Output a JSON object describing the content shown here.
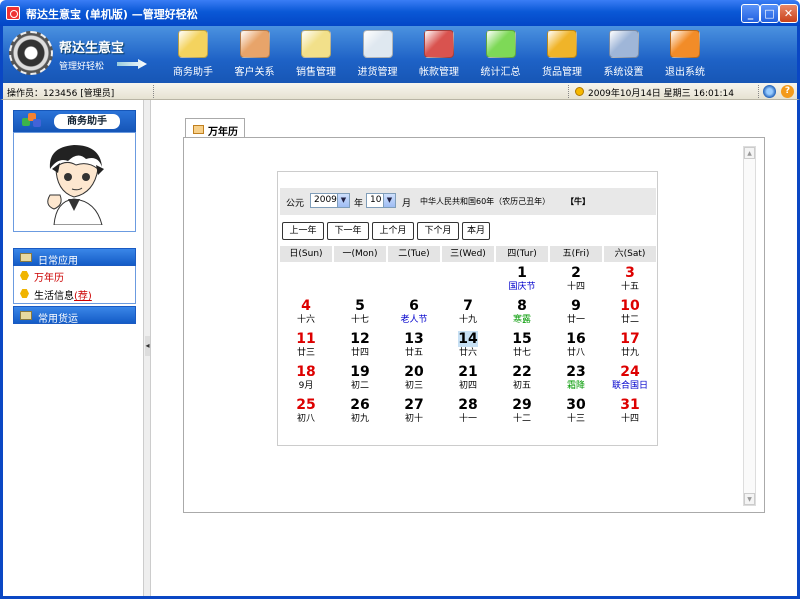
{
  "window": {
    "title": "帮达生意宝 (单机版) —管理好轻松"
  },
  "logo": {
    "name": "帮达生意宝",
    "slogan": "管理好轻松"
  },
  "toolbar": {
    "items": [
      {
        "label": "商务助手",
        "icon": "handshake-document-icon",
        "color": "#f4d35e"
      },
      {
        "label": "客户关系",
        "icon": "people-icon",
        "color": "#e8a46a"
      },
      {
        "label": "销售管理",
        "icon": "clipboard-icon",
        "color": "#f2e08a"
      },
      {
        "label": "进货管理",
        "icon": "notepad-pen-icon",
        "color": "#dfe8f0"
      },
      {
        "label": "帐款管理",
        "icon": "money-transfer-icon",
        "color": "#d9534f"
      },
      {
        "label": "统计汇总",
        "icon": "bar-chart-icon",
        "color": "#7ed957"
      },
      {
        "label": "货品管理",
        "icon": "boxes-icon",
        "color": "#f0b429"
      },
      {
        "label": "系统设置",
        "icon": "settings-panel-icon",
        "color": "#9fb6d8"
      },
      {
        "label": "退出系统",
        "icon": "exit-out-icon",
        "color": "#f28c28"
      }
    ]
  },
  "status": {
    "operator": "操作员：123456 [管理员]",
    "datetime": "2009年10月14日  星期三  16:01:14"
  },
  "sidebar": {
    "assistant_title": "商务助手",
    "daily_title": "日常应用",
    "items": [
      {
        "label": "万年历",
        "color": "#cc0000"
      },
      {
        "label": "生活信息",
        "badge": "(荐)",
        "color": "#000000"
      }
    ],
    "shipping_title": "常用货运"
  },
  "tab": {
    "label": "万年历"
  },
  "calendar": {
    "era_label": "公元",
    "year": "2009",
    "year_unit": "年",
    "month": "10",
    "month_unit": "月",
    "lunar_info": "中华人民共和国60年（农历己丑年）",
    "zodiac": "【牛】",
    "buttons": [
      "上一年",
      "下一年",
      "上个月",
      "下个月",
      "本月"
    ],
    "weekdays": [
      "日(Sun)",
      "一(Mon)",
      "二(Tue)",
      "三(Wed)",
      "四(Tur)",
      "五(Fri)",
      "六(Sat)"
    ],
    "first_weekday": 4,
    "today": 14,
    "days": [
      {
        "n": "1",
        "l": "国庆节",
        "lc": "#0000cc"
      },
      {
        "n": "2",
        "l": "十四"
      },
      {
        "n": "3",
        "l": "十五"
      },
      {
        "n": "4",
        "l": "十六"
      },
      {
        "n": "5",
        "l": "十七"
      },
      {
        "n": "6",
        "l": "老人节",
        "lc": "#0000cc"
      },
      {
        "n": "7",
        "l": "十九"
      },
      {
        "n": "8",
        "l": "寒露",
        "lc": "#009900"
      },
      {
        "n": "9",
        "l": "廿一"
      },
      {
        "n": "10",
        "l": "廿二"
      },
      {
        "n": "11",
        "l": "廿三"
      },
      {
        "n": "12",
        "l": "廿四"
      },
      {
        "n": "13",
        "l": "廿五"
      },
      {
        "n": "14",
        "l": "廿六"
      },
      {
        "n": "15",
        "l": "廿七"
      },
      {
        "n": "16",
        "l": "廿八"
      },
      {
        "n": "17",
        "l": "廿九"
      },
      {
        "n": "18",
        "l": "9月"
      },
      {
        "n": "19",
        "l": "初二"
      },
      {
        "n": "20",
        "l": "初三"
      },
      {
        "n": "21",
        "l": "初四"
      },
      {
        "n": "22",
        "l": "初五"
      },
      {
        "n": "23",
        "l": "霜降",
        "lc": "#009900"
      },
      {
        "n": "24",
        "l": "联合国日",
        "lc": "#0000cc"
      },
      {
        "n": "25",
        "l": "初八"
      },
      {
        "n": "26",
        "l": "初九"
      },
      {
        "n": "27",
        "l": "初十"
      },
      {
        "n": "28",
        "l": "十一"
      },
      {
        "n": "29",
        "l": "十二"
      },
      {
        "n": "30",
        "l": "十三"
      },
      {
        "n": "31",
        "l": "十四"
      }
    ],
    "weekend_color": "#dd0000"
  }
}
